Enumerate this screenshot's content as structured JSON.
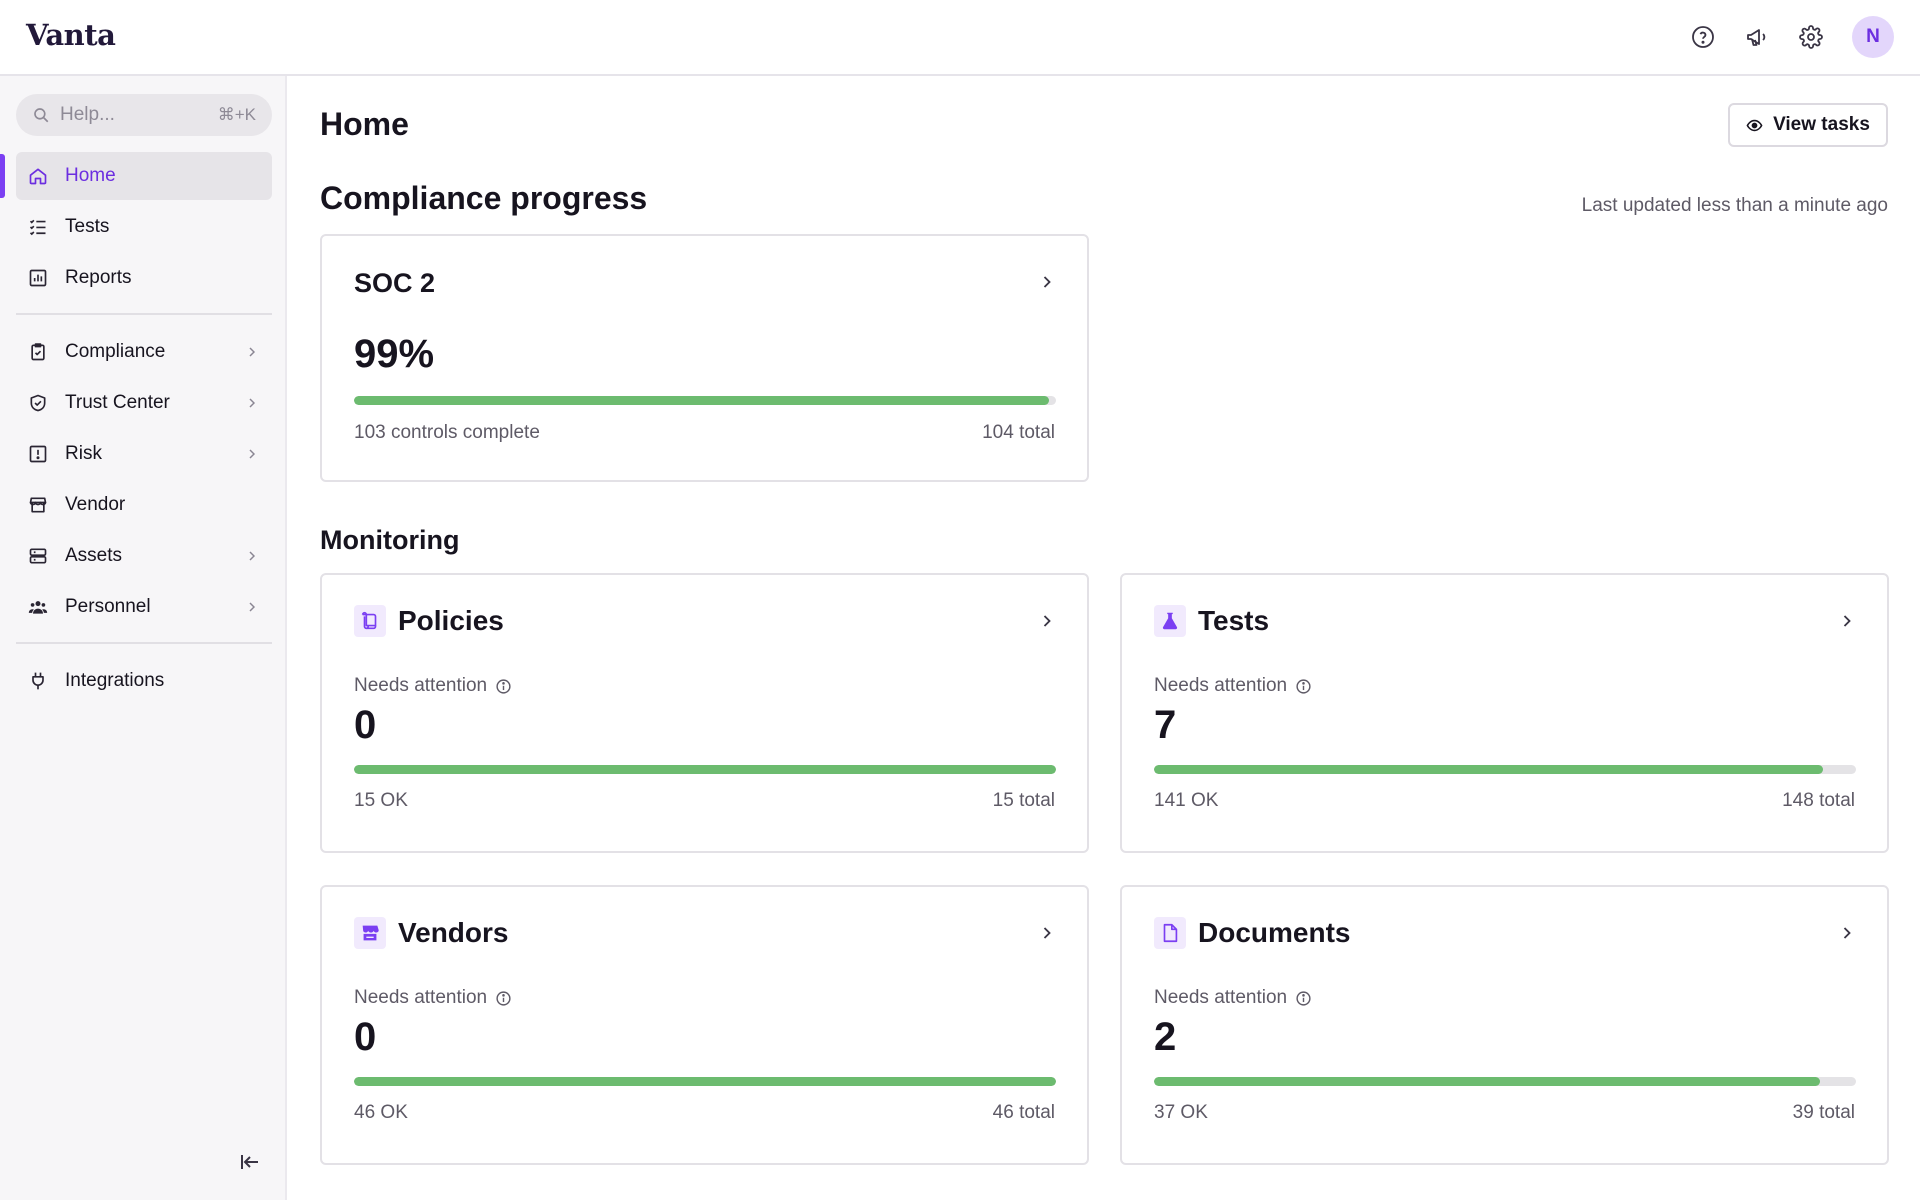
{
  "app": {
    "logo": "Vanta",
    "avatar_initial": "N"
  },
  "search": {
    "placeholder": "Help...",
    "shortcut": "⌘+K"
  },
  "sidebar": {
    "group1": [
      {
        "label": "Home",
        "icon": "home-icon",
        "active": true
      },
      {
        "label": "Tests",
        "icon": "checklist-icon"
      },
      {
        "label": "Reports",
        "icon": "chart-icon"
      }
    ],
    "group2": [
      {
        "label": "Compliance",
        "icon": "clipboard-check-icon",
        "chevron": true
      },
      {
        "label": "Trust Center",
        "icon": "shield-check-icon",
        "chevron": true
      },
      {
        "label": "Risk",
        "icon": "alert-square-icon",
        "chevron": true
      },
      {
        "label": "Vendor",
        "icon": "store-icon",
        "chevron": false
      },
      {
        "label": "Assets",
        "icon": "server-icon",
        "chevron": true
      },
      {
        "label": "Personnel",
        "icon": "users-icon",
        "chevron": true
      }
    ],
    "group3": [
      {
        "label": "Integrations",
        "icon": "plug-icon"
      }
    ]
  },
  "main": {
    "title": "Home",
    "view_tasks_label": "View tasks",
    "compliance": {
      "title": "Compliance progress",
      "updated": "Last updated less than a minute ago",
      "soc2": {
        "name": "SOC 2",
        "percent": "99%",
        "progress": 0.99,
        "complete": "103 controls complete",
        "total": "104 total"
      }
    },
    "monitoring": {
      "title": "Monitoring",
      "needs_label": "Needs attention",
      "cards": [
        {
          "title": "Policies",
          "icon": "policy-scroll-icon",
          "needs": "0",
          "ok": "15 OK",
          "total": "15 total",
          "progress": 1.0
        },
        {
          "title": "Tests",
          "icon": "flask-icon",
          "needs": "7",
          "ok": "141 OK",
          "total": "148 total",
          "progress": 0.953
        },
        {
          "title": "Vendors",
          "icon": "store-icon",
          "needs": "0",
          "ok": "46 OK",
          "total": "46 total",
          "progress": 1.0
        },
        {
          "title": "Documents",
          "icon": "document-icon",
          "needs": "2",
          "ok": "37 OK",
          "total": "39 total",
          "progress": 0.949
        }
      ]
    }
  },
  "colors": {
    "accent": "#7b3ff2",
    "progress": "#6cbb6f",
    "track": "#e4e3e6"
  }
}
